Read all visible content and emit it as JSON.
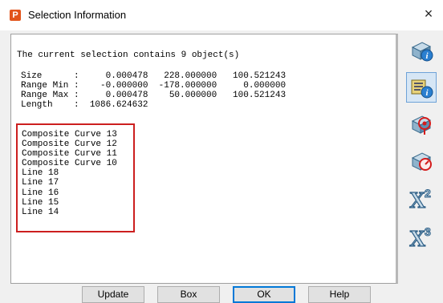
{
  "window": {
    "title": "Selection Information",
    "app_icon_letter": "P",
    "close_glyph": "×"
  },
  "output": {
    "summary": "The current selection contains 9 object(s)",
    "stats_text": "Size      :     0.000478   228.000000   100.521243\nRange Min :    -0.000000  -178.000000     0.000000\nRange Max :     0.000478    50.000000   100.521243\nLength    :  1086.624632",
    "stats": [
      {
        "label": "Size",
        "values": [
          "0.000478",
          "228.000000",
          "100.521243"
        ]
      },
      {
        "label": "Range Min",
        "values": [
          "-0.000000",
          "-178.000000",
          "0.000000"
        ]
      },
      {
        "label": "Range Max",
        "values": [
          "0.000478",
          "50.000000",
          "100.521243"
        ]
      },
      {
        "label": "Length",
        "values": [
          "1086.624632"
        ]
      }
    ],
    "objects_text": "Composite Curve 13\nComposite Curve 12\nComposite Curve 11\nComposite Curve 10\nLine 18\nLine 17\nLine 16\nLine 15\nLine 14",
    "objects": [
      "Composite Curve 13",
      "Composite Curve 12",
      "Composite Curve 11",
      "Composite Curve 10",
      "Line 18",
      "Line 17",
      "Line 16",
      "Line 15",
      "Line 14"
    ],
    "highlight_color": "#cc1f1f"
  },
  "side_buttons": [
    {
      "name": "info-icon",
      "active": false
    },
    {
      "name": "list-info-icon",
      "active": true
    },
    {
      "name": "pick-component-icon",
      "active": false
    },
    {
      "name": "measure-icon",
      "active": false
    },
    {
      "name": "x-squared-icon",
      "active": false
    },
    {
      "name": "x-cubed-icon",
      "active": false
    }
  ],
  "buttons": {
    "update": "Update",
    "box": "Box",
    "ok": "OK",
    "help": "Help"
  }
}
